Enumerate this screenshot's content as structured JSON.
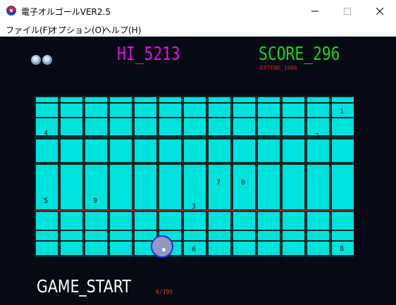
{
  "window": {
    "title": "電子オルゴールVER2.5",
    "controls": {
      "minimize": "—",
      "maximize": "☐",
      "close": "✕"
    }
  },
  "menu": [
    {
      "label": "ファイル(F)"
    },
    {
      "label": "オプション(O)"
    },
    {
      "label": "ヘルプ(H)"
    }
  ],
  "hud": {
    "hi": "HI_5213",
    "score": "SCORE_296",
    "extend": "EXTEND_1000",
    "lives": 2,
    "game_start": "GAME_START",
    "counter": "0/195"
  },
  "grid": {
    "columns": 13,
    "numbers": [
      "4",
      "2",
      "1",
      "5",
      "9",
      "7",
      "0",
      "3",
      "6",
      "8"
    ]
  },
  "colors": {
    "background": "#070a14",
    "cell": "#00e2dc",
    "hi": "#e010e0",
    "score": "#19d21f",
    "extend": "#e02020",
    "counter": "#e04020",
    "divider": "#8e1a26"
  }
}
